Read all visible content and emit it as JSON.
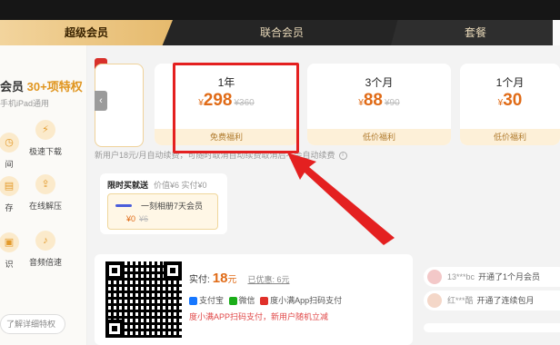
{
  "tabs": [
    {
      "label": "超级会员"
    },
    {
      "label": "联合会员"
    },
    {
      "label": "套餐"
    }
  ],
  "sidebar": {
    "title_prefix": "会员",
    "title_highlight": "30+项特权",
    "subtitle": "手机iPad通用",
    "features": [
      {
        "label": "间",
        "icon": "clock-icon"
      },
      {
        "label": "极速下载",
        "icon": "lightning-icon"
      },
      {
        "label": "存",
        "icon": "storage-icon"
      },
      {
        "label": "在线解压",
        "icon": "unzip-icon"
      },
      {
        "label": "识",
        "icon": "scan-icon"
      },
      {
        "label": "音频倍速",
        "icon": "audio-speed-icon"
      }
    ],
    "more_link": "了解详细特权"
  },
  "plans": [
    {
      "period": "1年",
      "currency": "¥",
      "price": "298",
      "original": "¥360",
      "tag": "免费福利"
    },
    {
      "period": "3个月",
      "currency": "¥",
      "price": "88",
      "original": "¥90",
      "tag": "低价福利"
    },
    {
      "period": "1个月",
      "currency": "¥",
      "price": "30",
      "original": "",
      "tag": "低价福利"
    }
  ],
  "notice": {
    "left": "新用户18元/月自动续费，可随时取消自动续费",
    "right": "取消后不会自动续费"
  },
  "promo": {
    "title": "限时买就送",
    "meta": "价值¥6 实付¥0",
    "item_name": "一刻相册7天会员",
    "item_price": "¥0",
    "item_original": "¥6"
  },
  "payment": {
    "label": "实付:",
    "amount": "18",
    "unit": "元",
    "discount": "已优惠: 6元",
    "methods": [
      "支付宝",
      "微信",
      "度小满App扫码支付"
    ],
    "note": "度小满APP扫码支付，新用户随机立减"
  },
  "feed": [
    {
      "user": "13***bc",
      "action": "开通了1个月会员"
    },
    {
      "user": "红***酷",
      "action": "开通了连续包月"
    }
  ],
  "colors": {
    "accent": "#e06b17",
    "highlight_box": "#e42020",
    "gold_tab": "#e6ba6d"
  }
}
